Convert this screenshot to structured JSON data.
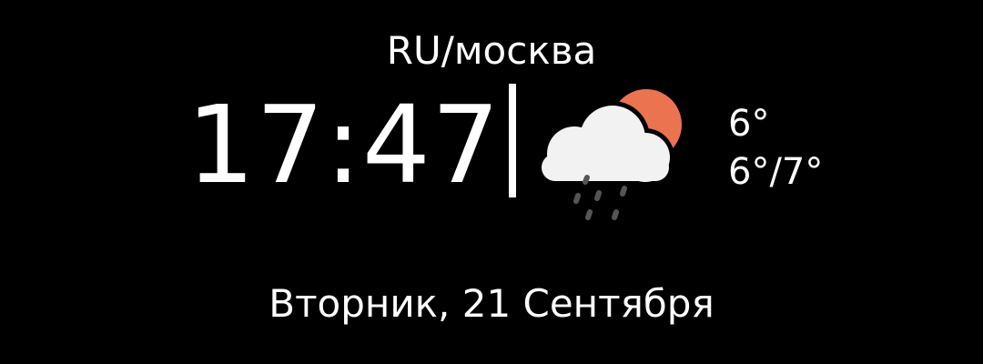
{
  "location": "RU/москва",
  "time": "17:47",
  "weather": {
    "icon": "cloud-sun-rain-icon",
    "current_temp": "6°",
    "range_temp": "6°/7°"
  },
  "date": "Вторник, 21 Сентября",
  "colors": {
    "background": "#000000",
    "text": "#ffffff",
    "sun": "#ec7350",
    "cloud": "#f2f2f2",
    "rain": "#555555"
  }
}
